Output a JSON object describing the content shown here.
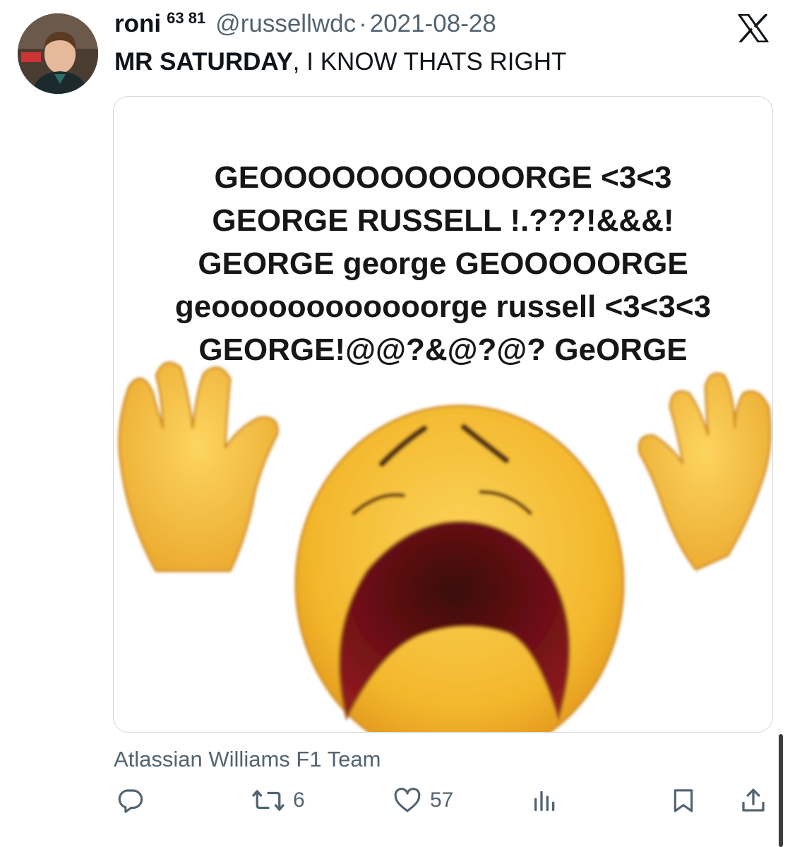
{
  "author": {
    "display_name": "roni",
    "name_suffix": "63 81",
    "handle": "@russellwdc",
    "separator": "·",
    "date": "2021-08-28"
  },
  "tweet": {
    "text_bold": "MR SATURDAY",
    "text_rest": ", I KNOW THATS RIGHT"
  },
  "media": {
    "lines": [
      "GEOOOOOOOOOOORGE <3<3",
      "GEORGE RUSSELL !.???!&&&!",
      "GEORGE george GEOOOOORGE",
      "geoooooooooooorge russell <3<3<3",
      "GEORGE!@@?&@?@? GeORGE"
    ]
  },
  "affiliation": "Atlassian Williams F1 Team",
  "actions": {
    "reply_icon": "reply-icon",
    "retweet_icon": "retweet-icon",
    "retweet_count": "6",
    "like_icon": "heart-icon",
    "like_count": "57",
    "views_icon": "views-icon",
    "bookmark_icon": "bookmark-icon",
    "share_icon": "share-icon"
  },
  "colors": {
    "primary_text": "#0f1419",
    "secondary_text": "#536471",
    "border": "#cfd9de",
    "emoji_yellow": "#f7c23a",
    "emoji_mouth": "#7a1418"
  }
}
